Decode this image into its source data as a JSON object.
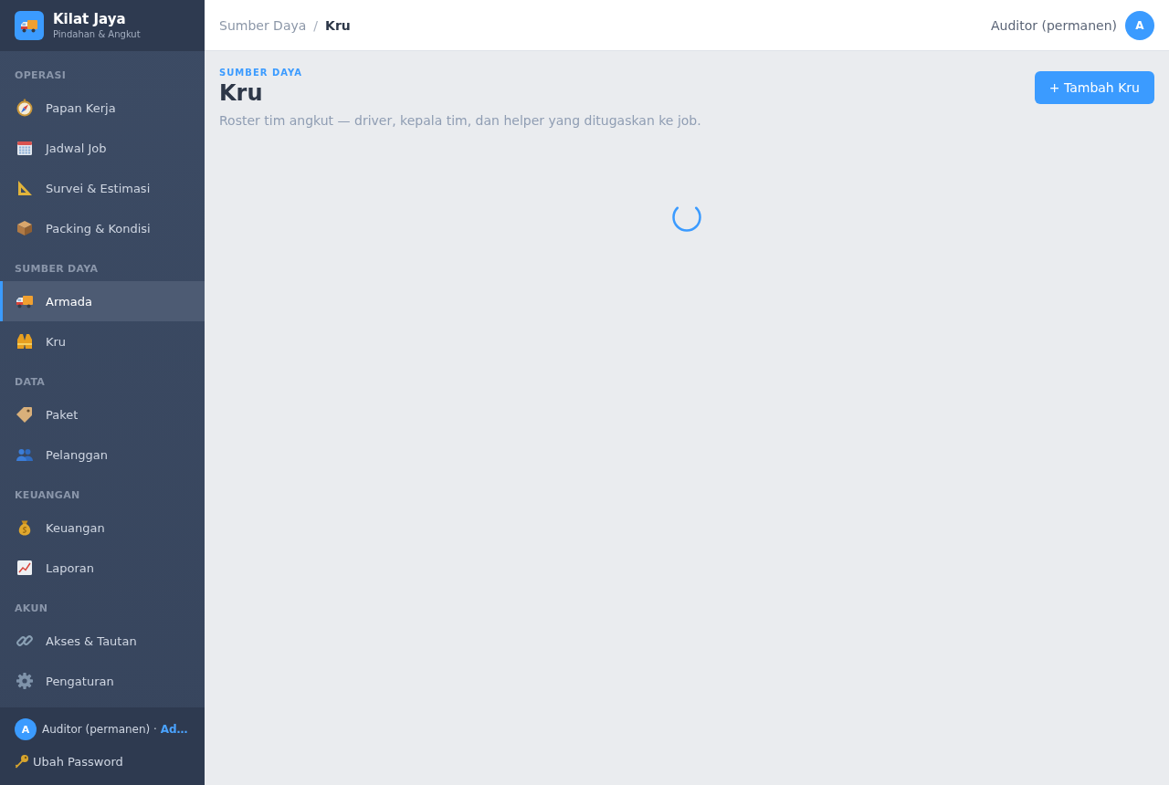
{
  "sidebar": {
    "brand": {
      "name": "Kilat Jaya",
      "tagline": "Pindahan & Angkut"
    },
    "sections": [
      {
        "title": "OPERASI",
        "items": [
          {
            "label": "Papan Kerja",
            "selected": false
          },
          {
            "label": "Jadwal Job",
            "selected": false
          },
          {
            "label": "Survei & Estimasi",
            "selected": false
          },
          {
            "label": "Packing & Kondisi",
            "selected": false
          }
        ]
      },
      {
        "title": "SUMBER DAYA",
        "items": [
          {
            "label": "Armada",
            "selected": true
          },
          {
            "label": "Kru",
            "selected": false
          }
        ]
      },
      {
        "title": "DATA",
        "items": [
          {
            "label": "Paket",
            "selected": false
          },
          {
            "label": "Pelanggan",
            "selected": false
          }
        ]
      },
      {
        "title": "KEUANGAN",
        "items": [
          {
            "label": "Keuangan",
            "selected": false
          },
          {
            "label": "Laporan",
            "selected": false
          }
        ]
      },
      {
        "title": "AKUN",
        "items": [
          {
            "label": "Akses & Tautan",
            "selected": false
          },
          {
            "label": "Pengaturan",
            "selected": false
          }
        ]
      }
    ],
    "footer": {
      "avatar_initial": "A",
      "user": "Auditor (permanen) · **Ad…**",
      "change_password": "Ubah Password"
    }
  },
  "topbar": {
    "breadcrumb": [
      {
        "label": "Sumber Daya",
        "current": false
      },
      {
        "label": "Kru",
        "current": true
      }
    ],
    "separator": "/",
    "user_name": "Auditor (permanen)",
    "avatar_initial": "A"
  },
  "page": {
    "eyebrow": "SUMBER DAYA",
    "title": "Kru",
    "subtitle": "Roster tim angkut — driver, kepala tim, dan helper yang ditugaskan ke job.",
    "primary_button": "+ Tambah Kru",
    "loading": true
  }
}
